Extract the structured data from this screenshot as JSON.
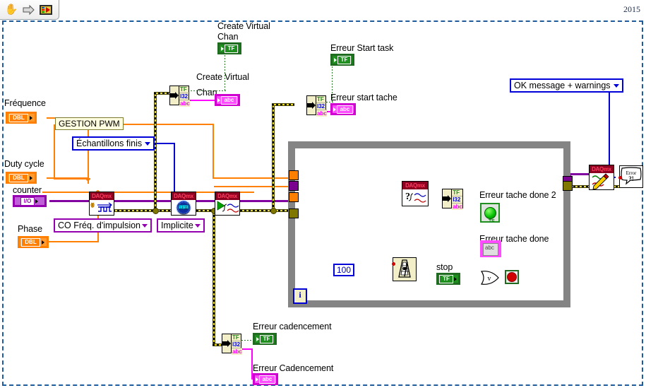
{
  "window": {
    "version_label": "2015",
    "toolbar": {
      "hand_tool": "hand-tool",
      "run_arrow": "run-arrow",
      "vi_icon": "vi-icon"
    }
  },
  "controls": {
    "frequence": {
      "label": "Fréquence",
      "type": "DBL"
    },
    "duty_cycle": {
      "label": "Duty cycle",
      "type": "DBL"
    },
    "counter": {
      "label": "counter",
      "type": "I/O"
    },
    "phase": {
      "label": "Phase",
      "type": "DBL"
    },
    "stop": {
      "label": "stop",
      "type": "TF"
    }
  },
  "indicators": {
    "create_virtual_chan_bool": {
      "label": "Create Virtual\nChan",
      "line1": "Create Virtual",
      "line2": "Chan",
      "type": "TF"
    },
    "create_virtual_chan_str": {
      "line1": "Create Virtual",
      "line2": "Chan",
      "type": "abc"
    },
    "erreur_start_task": {
      "label": "Erreur Start task",
      "type": "TF"
    },
    "erreur_start_tache": {
      "label": "Erreur start tache",
      "type": "abc"
    },
    "erreur_cadencement_bool": {
      "label": "Erreur cadencement",
      "type": "TF"
    },
    "erreur_cadencement_str": {
      "label": "Erreur Cadencement",
      "type": "abc"
    },
    "erreur_tache_done_2": {
      "label": "Erreur tache done 2",
      "type": "TF"
    },
    "erreur_tache_done": {
      "label": "Erreur tache done",
      "type": "abc"
    }
  },
  "constants": {
    "gestion_pwm": "GESTION PWM",
    "wait_ms": "100"
  },
  "enums": {
    "echantillons_finis": {
      "value": "Échantillons finis",
      "color": "#0000d8"
    },
    "co_freq_impulsion": {
      "value": "CO Fréq. d'impulsion",
      "color": "#9400b0"
    },
    "implicite": {
      "value": "Implicite",
      "color": "#9400b0"
    },
    "ok_message_warnings": {
      "value": "OK message + warnings",
      "color": "#0000d8"
    }
  },
  "nodes": {
    "daqmx_create_channel": {
      "header": "DAQmx",
      "name": "daqmx-create-virtual-channel"
    },
    "daqmx_timing": {
      "header": "DAQmx",
      "name": "daqmx-timing"
    },
    "daqmx_start_task": {
      "header": "DAQmx",
      "name": "daqmx-start-task"
    },
    "daqmx_is_task_done": {
      "header": "DAQmx",
      "name": "daqmx-is-task-done"
    },
    "daqmx_clear_task": {
      "header": "DAQmx",
      "name": "daqmx-clear-task"
    },
    "simple_error_handler": {
      "label": "Error",
      "sub": "?!",
      "name": "simple-error-handler"
    },
    "wait_until_next_ms": {
      "name": "wait-until-next-ms-multiple"
    },
    "or_gate": {
      "symbol": "v",
      "name": "or-gate"
    }
  },
  "unbundle_fields": {
    "f1": "TF",
    "f2": "I32",
    "f3": "abc"
  },
  "loop": {
    "iteration_terminal": "i",
    "name": "while-loop"
  },
  "colors": {
    "wire_orange": "#ff8000",
    "wire_blue": "#0000d8",
    "wire_purple": "#8000a0",
    "wire_pink": "#ff00ff",
    "wire_error": "#e8dc28",
    "wire_boolean": "#2d7a2d",
    "loop_border": "#848484",
    "canvas_border": "#1f5c9e"
  }
}
